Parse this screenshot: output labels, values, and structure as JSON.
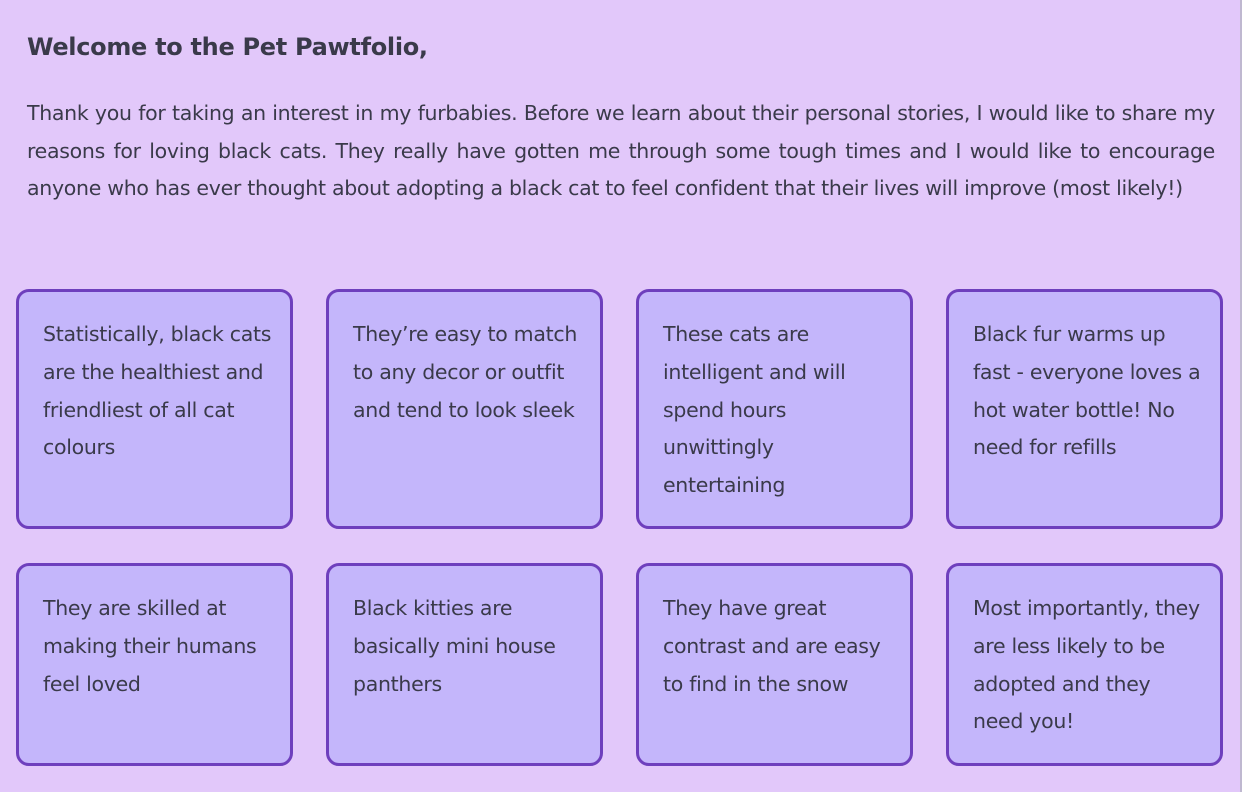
{
  "page": {
    "title": "Welcome to the Pet Pawtfolio,",
    "intro": "Thank you for taking an interest in my furbabies. Before we learn about their personal stories, I would like to share my reasons for loving black cats. They really have gotten me through some tough times and I would like to encourage anyone who has ever thought about adopting a black cat to feel confident that their lives will improve (most likely!)"
  },
  "reasons": [
    "Statistically, black cats are the healthiest and friendliest of all cat colours",
    "They’re easy to match to any decor or outfit and tend to look sleek",
    "These cats are intelligent and will spend hours unwittingly entertaining",
    "Black fur warms up fast - everyone loves a hot water bottle! No need for refills",
    "They are skilled at making their humans feel loved",
    "Black kitties are basically mini house panthers",
    "They have great contrast and are easy to find in the snow",
    "Most importantly, they are less likely to be adopted and they need you!"
  ],
  "colors": {
    "background": "#e2c8fa",
    "card_fill": "#c4b6fb",
    "card_border": "#6e3fbd",
    "text": "#3a3a4a"
  }
}
